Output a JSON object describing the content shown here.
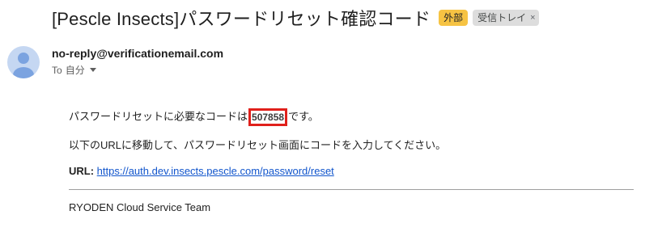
{
  "email": {
    "subject": "[Pescle Insects]パスワードリセット確認コード",
    "labels": {
      "external": "外部",
      "inbox": "受信トレイ",
      "remove": "×"
    },
    "sender": "no-reply@verificationemail.com",
    "to": {
      "prefix": "To",
      "recipient": "自分"
    },
    "body": {
      "line1_before": "パスワードリセットに必要なコードは",
      "code": "507858",
      "line1_after": "です。",
      "line2": "以下のURLに移動して、パスワードリセット画面にコードを入力してください。",
      "url_label": "URL:",
      "url": "https://auth.dev.insects.pescle.com/password/reset",
      "signature": "RYODEN Cloud Service Team"
    }
  },
  "colors": {
    "external_badge": "#f6c343",
    "code_highlight_border": "#e0201b",
    "link": "#1155cc"
  },
  "icons": {
    "avatar": "default-person-avatar",
    "recipient_toggle": "chevron-down"
  }
}
